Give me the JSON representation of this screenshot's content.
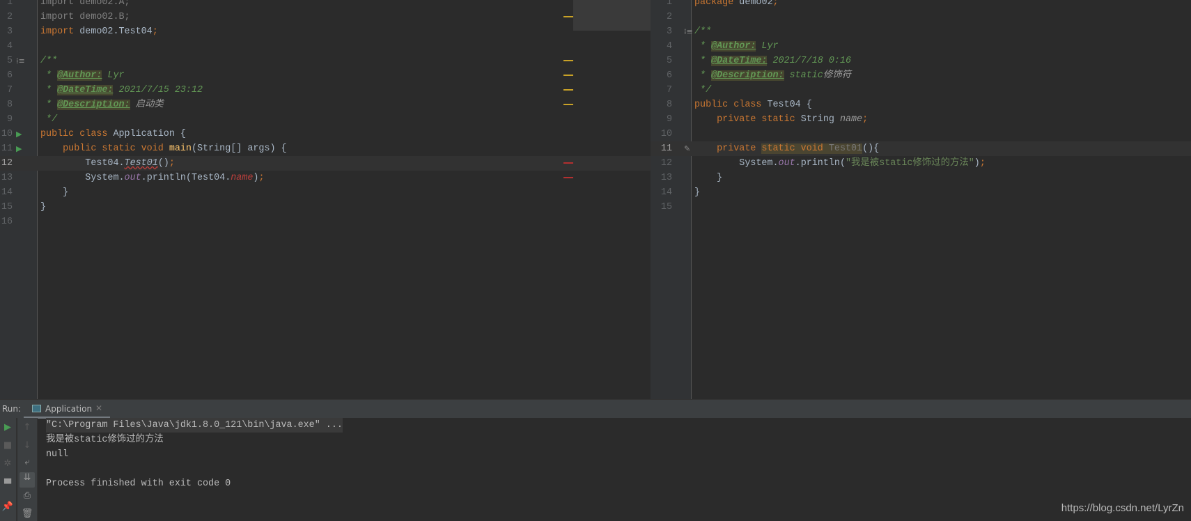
{
  "left_editor": {
    "current_line": 12,
    "lines": [
      [
        [
          "unused",
          "import demo02.A;"
        ]
      ],
      [
        [
          "unused",
          "import demo02.B;"
        ]
      ],
      [
        [
          "kw",
          "import "
        ],
        [
          "plain",
          "demo02.Test04"
        ],
        [
          "kw",
          ";"
        ]
      ],
      [],
      [
        [
          "cmt",
          "/**"
        ]
      ],
      [
        [
          "cmt",
          " * "
        ],
        [
          "tag",
          "@Author:"
        ],
        [
          "cmt",
          " Lyr"
        ]
      ],
      [
        [
          "cmt",
          " * "
        ],
        [
          "tag",
          "@DateTime:"
        ],
        [
          "cmt",
          " 2021/7/15 23:12"
        ]
      ],
      [
        [
          "cmt",
          " * "
        ],
        [
          "tag",
          "@Description:"
        ],
        [
          "cmt",
          " "
        ],
        [
          "gry",
          "启动类"
        ]
      ],
      [
        [
          "cmt",
          " */"
        ]
      ],
      [
        [
          "kw",
          "public class "
        ],
        [
          "plain",
          "Application {"
        ]
      ],
      [
        [
          "kw",
          "    public static void "
        ],
        [
          "fn",
          "main"
        ],
        [
          "plain",
          "(String[] args) {"
        ]
      ],
      [
        [
          "plain",
          "        Test04."
        ],
        [
          "errcall",
          "Test01"
        ],
        [
          "plain",
          "()"
        ],
        [
          "kw",
          ";"
        ]
      ],
      [
        [
          "plain",
          "        System."
        ],
        [
          "fld",
          "out"
        ],
        [
          "plain",
          ".println(Test04."
        ],
        [
          "err",
          "name"
        ],
        [
          "plain",
          ")"
        ],
        [
          "kw",
          ";"
        ]
      ],
      [
        [
          "plain",
          "    }"
        ]
      ],
      [
        [
          "plain",
          "}"
        ]
      ],
      []
    ],
    "gutter_icons": {
      "5": "doc-render-icon",
      "10": "run-icon",
      "11": "run-icon"
    },
    "stripe_marks": [
      {
        "line": 2,
        "color": "#c9a227"
      },
      {
        "line": 5,
        "color": "#c9a227"
      },
      {
        "line": 6,
        "color": "#c9a227"
      },
      {
        "line": 7,
        "color": "#c9a227"
      },
      {
        "line": 8,
        "color": "#c9a227"
      },
      {
        "line": 12,
        "color": "#b23030"
      },
      {
        "line": 13,
        "color": "#b23030"
      }
    ]
  },
  "right_editor": {
    "current_line": 11,
    "lines": [
      [
        [
          "kw",
          "package "
        ],
        [
          "plain",
          "demo02"
        ],
        [
          "kw",
          ";"
        ]
      ],
      [],
      [
        [
          "cmt",
          "/**"
        ]
      ],
      [
        [
          "cmt",
          " * "
        ],
        [
          "tag",
          "@Author:"
        ],
        [
          "cmt",
          " Lyr"
        ]
      ],
      [
        [
          "cmt",
          " * "
        ],
        [
          "tag",
          "@DateTime:"
        ],
        [
          "cmt",
          " 2021/7/18 0:16"
        ]
      ],
      [
        [
          "cmt",
          " * "
        ],
        [
          "tag",
          "@Description:"
        ],
        [
          "cmt",
          " static"
        ],
        [
          "gry",
          "修饰符"
        ]
      ],
      [
        [
          "cmt",
          " */"
        ]
      ],
      [
        [
          "kw",
          "public class "
        ],
        [
          "plain",
          "Test04 {"
        ]
      ],
      [
        [
          "kw",
          "    private static "
        ],
        [
          "plain",
          "String "
        ],
        [
          "gry",
          "name"
        ],
        [
          "kw",
          ";"
        ]
      ],
      [],
      [
        [
          "kw",
          "    private "
        ],
        [
          "kwhl",
          "static void "
        ],
        [
          "mutedhl",
          "Test01"
        ],
        [
          "plain",
          "(){"
        ]
      ],
      [
        [
          "plain",
          "        System."
        ],
        [
          "fld",
          "out"
        ],
        [
          "plain",
          ".println("
        ],
        [
          "str",
          "\"我是被static修饰过的方法\""
        ],
        [
          "plain",
          ")"
        ],
        [
          "kw",
          ";"
        ]
      ],
      [
        [
          "plain",
          "    }"
        ]
      ],
      [
        [
          "plain",
          "}"
        ]
      ],
      []
    ],
    "gutter_icons": {
      "3": "doc-render-icon",
      "11": "edit-method-icon"
    }
  },
  "run_panel": {
    "label": "Run:",
    "tab": "Application",
    "console": [
      "\"C:\\Program Files\\Java\\jdk1.8.0_121\\bin\\java.exe\" ...",
      "我是被static修饰过的方法",
      "null",
      "",
      "Process finished with exit code 0"
    ]
  },
  "watermark": "https://blog.csdn.net/LyrZn",
  "colors": {
    "background": "#2b2b2b",
    "keyword": "#cc7832",
    "comment": "#629755",
    "string": "#6a8759",
    "field": "#9876aa",
    "error": "#bc3f3c",
    "run_green": "#499c54"
  }
}
